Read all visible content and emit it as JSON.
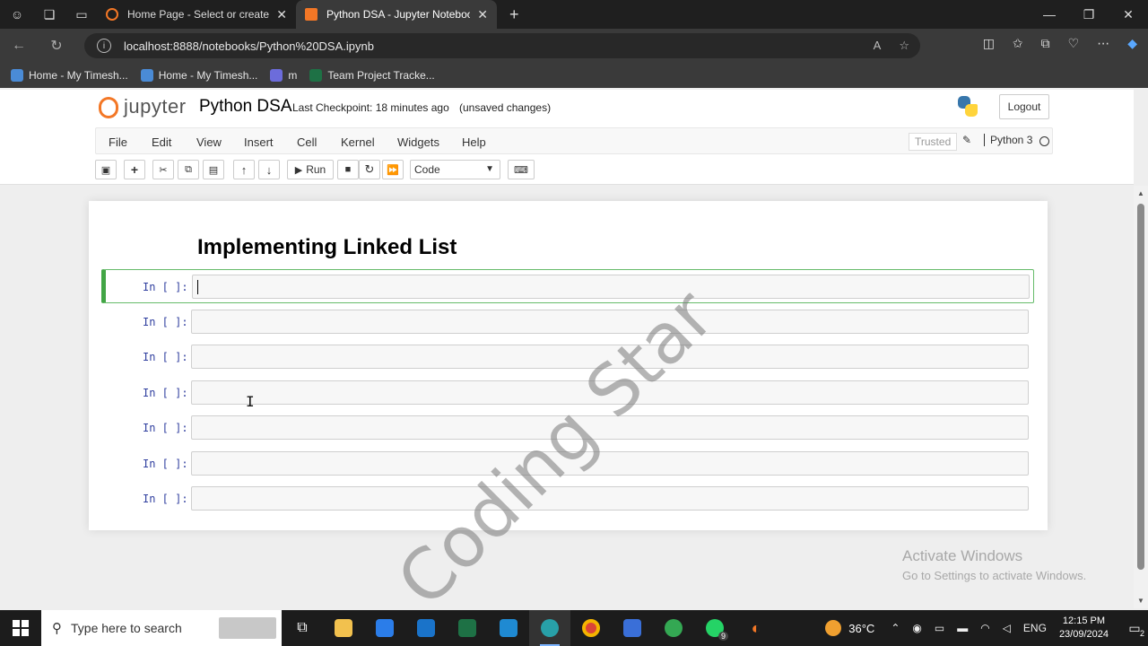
{
  "browser": {
    "tabs": [
      {
        "title": "Home Page - Select or create a no",
        "active": false
      },
      {
        "title": "Python DSA - Jupyter Notebook",
        "active": true
      }
    ],
    "url": "localhost:8888/notebooks/Python%20DSA.ipynb",
    "bookmarks": [
      "Home - My Timesh...",
      "Home - My Timesh...",
      "m",
      "Team Project Tracke..."
    ]
  },
  "jupyter": {
    "logo_text": "jupyter",
    "notebook_name": "Python DSA",
    "checkpoint": "Last Checkpoint: 18 minutes ago",
    "unsaved": "(unsaved changes)",
    "logout": "Logout",
    "menu": [
      "File",
      "Edit",
      "View",
      "Insert",
      "Cell",
      "Kernel",
      "Widgets",
      "Help"
    ],
    "trusted": "Trusted",
    "kernel": "Python 3",
    "toolbar": {
      "run": "Run",
      "cell_type": "Code"
    }
  },
  "notebook": {
    "heading": "Implementing Linked List",
    "cells": [
      {
        "prompt": "In [ ]:",
        "selected": true
      },
      {
        "prompt": "In [ ]:",
        "selected": false
      },
      {
        "prompt": "In [ ]:",
        "selected": false
      },
      {
        "prompt": "In [ ]:",
        "selected": false
      },
      {
        "prompt": "In [ ]:",
        "selected": false
      },
      {
        "prompt": "In [ ]:",
        "selected": false
      },
      {
        "prompt": "In [ ]:",
        "selected": false
      }
    ]
  },
  "overlay": {
    "watermark": "Coding Star",
    "activate_line1": "Activate Windows",
    "activate_line2": "Go to Settings to activate Windows."
  },
  "taskbar": {
    "search_placeholder": "Type here to search",
    "temperature": "36°C",
    "language": "ENG",
    "time": "12:15 PM",
    "date": "23/09/2024",
    "whatsapp_badge": "9",
    "notifications_badge": "2"
  },
  "colors": {
    "jupyter_orange": "#f37726",
    "selected_cell_green": "#42a545",
    "prompt_blue": "#303f9f"
  }
}
